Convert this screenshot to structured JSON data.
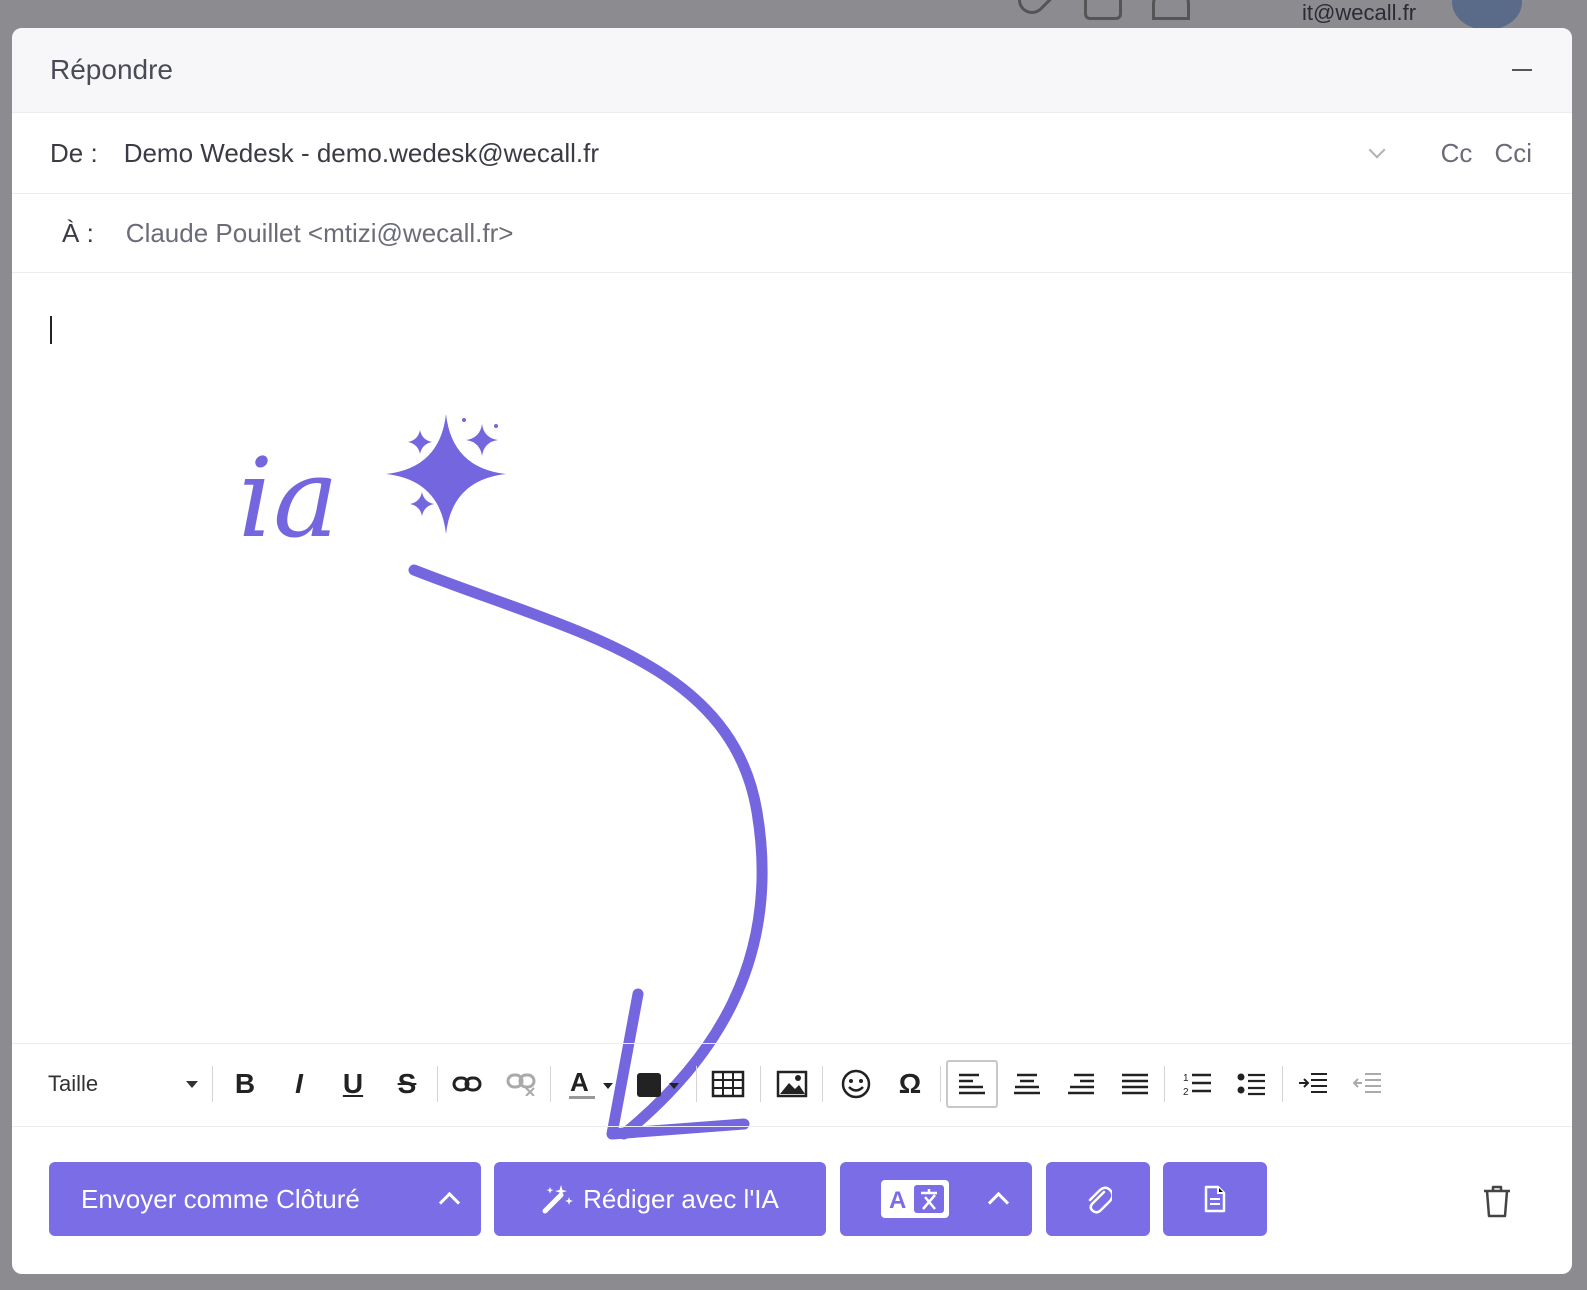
{
  "background": {
    "user_email": "it@wecall.fr"
  },
  "modal": {
    "title": "Répondre",
    "from": {
      "label": "De :",
      "value": "Demo Wedesk - demo.wedesk@wecall.fr",
      "cc_label": "Cc",
      "bcc_label": "Cci"
    },
    "to": {
      "label": "À :",
      "value": "Claude Pouillet <mtizi@wecall.fr>"
    },
    "annotation": {
      "text": "ia"
    },
    "toolbar": {
      "size_label": "Taille",
      "buttons": [
        "bold",
        "italic",
        "underline",
        "strikethrough",
        "link",
        "unlink",
        "text-color",
        "background-color",
        "table",
        "image",
        "emoji",
        "special-character",
        "align-left",
        "align-center",
        "align-right",
        "justify",
        "ordered-list",
        "unordered-list",
        "indent",
        "outdent"
      ],
      "active": "align-left"
    },
    "footer": {
      "send_label": "Envoyer comme Clôturé",
      "ai_label": "Rédiger avec l'IA",
      "translate_icon_text": "A"
    }
  },
  "colors": {
    "accent": "#7a6de6",
    "annotation": "#7466de"
  }
}
